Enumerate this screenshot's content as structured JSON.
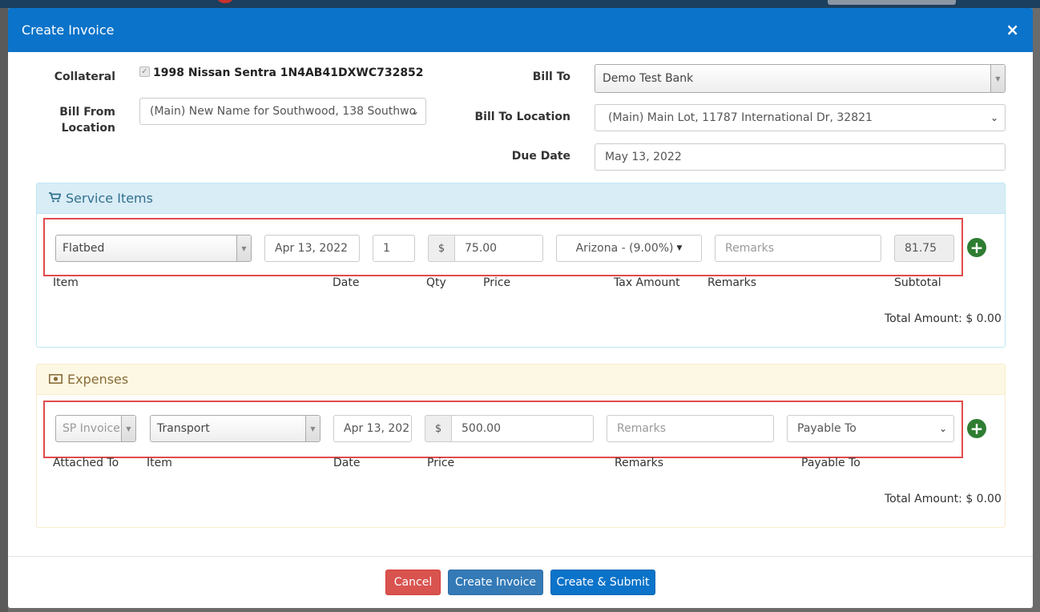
{
  "modal": {
    "title": "Create Invoice",
    "close_label": "×"
  },
  "form": {
    "collateral_label": "Collateral",
    "collateral_value": "1998 Nissan Sentra 1N4AB41DXWC732852",
    "bill_from_label_line1": "Bill From",
    "bill_from_label_line2": "Location",
    "bill_from_value": "(Main) New Name for Southwood, 138 Southwo",
    "bill_to_label": "Bill To",
    "bill_to_value": "Demo Test Bank",
    "bill_to_location_label": "Bill To Location",
    "bill_to_location_value": "(Main) Main Lot, 11787 International Dr, 32821",
    "due_date_label": "Due Date",
    "due_date_value": "May 13, 2022"
  },
  "service_items": {
    "heading": "Service Items",
    "row": {
      "item": "Flatbed",
      "date": "Apr 13, 2022",
      "qty": "1",
      "currency": "$",
      "price": "75.00",
      "tax": "Arizona - (9.00%)",
      "remarks_placeholder": "Remarks",
      "subtotal": "81.75"
    },
    "columns": {
      "item": "Item",
      "date": "Date",
      "qty": "Qty",
      "price": "Price",
      "tax": "Tax Amount",
      "remarks": "Remarks",
      "subtotal": "Subtotal"
    },
    "total": "Total Amount: $ 0.00"
  },
  "expenses": {
    "heading": "Expenses",
    "row": {
      "attached_to": "SP Invoice",
      "item": "Transport",
      "date": "Apr 13, 202",
      "currency": "$",
      "price": "500.00",
      "remarks_placeholder": "Remarks",
      "payable_to": "Payable To"
    },
    "columns": {
      "attached_to": "Attached To",
      "item": "Item",
      "date": "Date",
      "price": "Price",
      "remarks": "Remarks",
      "payable_to": "Payable To"
    },
    "total": "Total Amount: $ 0.00"
  },
  "footer": {
    "cancel": "Cancel",
    "create": "Create Invoice",
    "create_submit": "Create & Submit"
  },
  "icons": {
    "cart": "cart-icon",
    "money": "money-icon",
    "plus": "plus-circle-icon",
    "checkbox": "checkbox-icon"
  },
  "colors": {
    "header": "#0b73c9",
    "info_panel": "#d9edf7",
    "warn_panel": "#fcf8e3",
    "highlight": "#e04c4c",
    "add_button": "#2e7d32",
    "cancel": "#d9534f"
  }
}
